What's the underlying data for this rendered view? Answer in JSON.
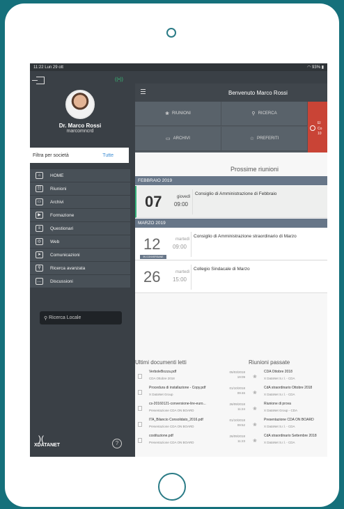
{
  "status": {
    "time": "11:22",
    "date": "Lun 29 ott",
    "battery": "93%"
  },
  "user": {
    "name": "Dr. Marco Rossi",
    "login": "marcomncrd"
  },
  "filter": {
    "label": "Filtra per società",
    "value": "Tutte"
  },
  "menu": [
    {
      "label": "HOME",
      "icon": "home-icon",
      "glyph": "⌂"
    },
    {
      "label": "Riunioni",
      "icon": "meetings-icon",
      "glyph": "☷"
    },
    {
      "label": "Archivi",
      "icon": "archive-icon",
      "glyph": "▭"
    },
    {
      "label": "Formazione",
      "icon": "training-icon",
      "glyph": "▶"
    },
    {
      "label": "Questionari",
      "icon": "questionnaire-icon",
      "glyph": "≡"
    },
    {
      "label": "Web",
      "icon": "web-icon",
      "glyph": "◎"
    },
    {
      "label": "Comunicazioni",
      "icon": "send-icon",
      "glyph": "➤"
    },
    {
      "label": "Ricerca avanzata",
      "icon": "search-icon",
      "glyph": "⚲"
    },
    {
      "label": "Discussioni",
      "icon": "chat-icon",
      "glyph": "…"
    }
  ],
  "local_search": {
    "placeholder": "Ricerca Locale"
  },
  "brand": {
    "name": "XDATANET"
  },
  "header": {
    "title": "Benvenuto Marco Rossi"
  },
  "quick": {
    "riunioni": "RIUNIONI",
    "ricerca": "RICERCA",
    "archivi": "ARCHIVI",
    "preferiti": "PREFERITI",
    "red_line1": "El",
    "red_line2": "Co",
    "red_line3": "10"
  },
  "next": {
    "title": "Prossime riunioni",
    "months": [
      {
        "label": "FEBBRAIO 2019"
      },
      {
        "label": "MARZO 2019"
      }
    ],
    "meetings": [
      {
        "day": "07",
        "weekday": "giovedì",
        "time": "09:00",
        "subject": "Consiglio di Amministrazione di Febbraio"
      },
      {
        "day": "12",
        "weekday": "martedì",
        "time": "09:00",
        "subject": "Consiglio di Amministrazione straordinario di Marzo",
        "badge": "IN CONVERSANE"
      },
      {
        "day": "26",
        "weekday": "martedì",
        "time": "15:00",
        "subject": "Collegio Sindacale di Marzo"
      }
    ]
  },
  "docs": {
    "title": "Ultimi documenti letti",
    "items": [
      {
        "name": "VerboleBozza.pdf",
        "sub": "CDA Ottobre 2018",
        "date": "05/03/2018",
        "time": "19:09"
      },
      {
        "name": "Procedura di installazione - Copy.pdf",
        "sub": "X DataNet Group",
        "date": "01/10/2018",
        "time": "09:46"
      },
      {
        "name": "cs-20160121-conversione-lire-euro...",
        "sub": "Presentazione CDA ON BOARD",
        "date": "26/09/2018",
        "time": "11:24"
      },
      {
        "name": "ITA_Bilancio Consolidato_2016.pdf",
        "sub": "Presentazione CDA ON BOARD",
        "date": "01/10/2018",
        "time": "09:52"
      },
      {
        "name": "costituzione.pdf",
        "sub": "Presentazione CDA ON BOARD",
        "date": "26/09/2018",
        "time": "11:23"
      }
    ]
  },
  "past": {
    "title": "Riunioni passate",
    "items": [
      {
        "name": "CDA Ottobre 2018",
        "sub": "X DataNet S.r.l. - CDA"
      },
      {
        "name": "CdA straordinario Ottobre 2018",
        "sub": "X DataNet S.r.l. - CDA"
      },
      {
        "name": "Riunione di prova",
        "sub": "X DataNet Group - CDA"
      },
      {
        "name": "Presentazione CDA ON BOARD",
        "sub": "X DataNet S.r.l. - CDA"
      },
      {
        "name": "CdA straordinario Settembre 2018",
        "sub": "X DataNet S.r.l. - CDA"
      }
    ]
  }
}
